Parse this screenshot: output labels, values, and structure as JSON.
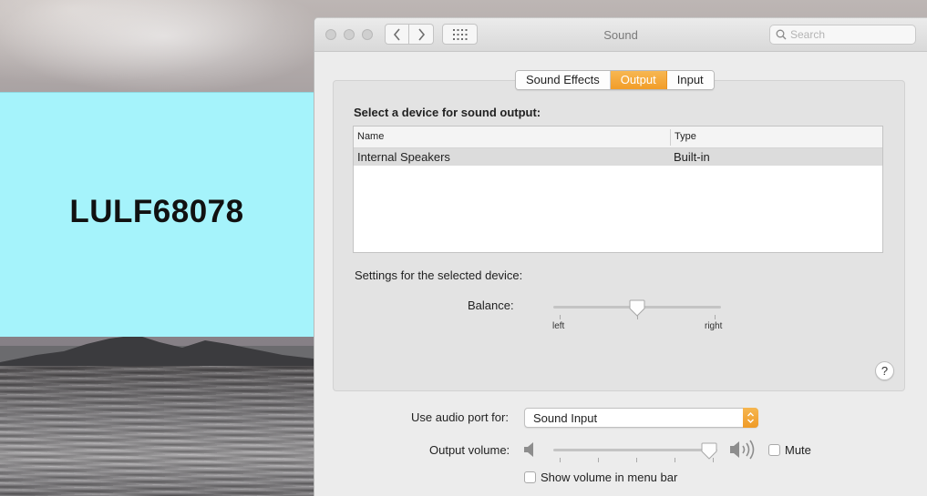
{
  "overlay": {
    "code": "LULF68078"
  },
  "window": {
    "title": "Sound",
    "search_placeholder": "Search"
  },
  "tabs": [
    {
      "label": "Sound Effects",
      "active": false
    },
    {
      "label": "Output",
      "active": true
    },
    {
      "label": "Input",
      "active": false
    }
  ],
  "output": {
    "heading": "Select a device for sound output:",
    "columns": {
      "name": "Name",
      "type": "Type"
    },
    "devices": [
      {
        "name": "Internal Speakers",
        "type": "Built-in",
        "selected": true
      }
    ],
    "settings_heading": "Settings for the selected device:",
    "balance": {
      "label": "Balance:",
      "left_label": "left",
      "right_label": "right",
      "value": 0.5
    }
  },
  "help": {
    "label": "?"
  },
  "audio_port": {
    "label": "Use audio port for:",
    "value": "Sound Input"
  },
  "volume": {
    "label": "Output volume:",
    "value": 0.95,
    "mute_label": "Mute",
    "muted": false
  },
  "menubar": {
    "label": "Show volume in menu bar",
    "checked": false
  },
  "colors": {
    "accent": "#f29d28",
    "overlay_bg": "#a5f3fb",
    "selected_row": "#dcdcdc"
  },
  "icons": {
    "speaker_low": "speaker-low-icon",
    "speaker_high": "speaker-high-icon",
    "search": "search-icon",
    "help": "help-icon"
  }
}
